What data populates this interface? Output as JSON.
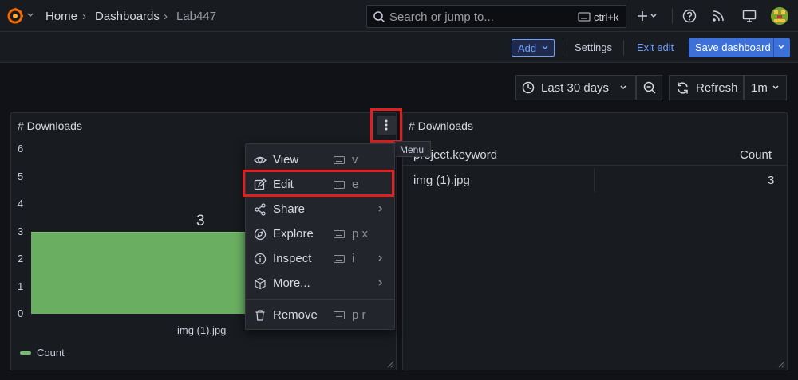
{
  "nav": {
    "breadcrumbs": [
      "Home",
      "Dashboards",
      "Lab447"
    ],
    "search_placeholder": "Search or jump to...",
    "search_shortcut": "ctrl+k"
  },
  "toolbar": {
    "add_label": "Add",
    "settings_label": "Settings",
    "exit_edit_label": "Exit edit",
    "save_label": "Save dashboard"
  },
  "time": {
    "range_label": "Last 30 days",
    "refresh_label": "Refresh",
    "interval_label": "1m"
  },
  "panel_left": {
    "title": "# Downloads",
    "tooltip": "Menu",
    "chart_data": {
      "type": "bar",
      "categories": [
        "img (1).jpg"
      ],
      "series": [
        {
          "name": "Count",
          "values": [
            3
          ]
        }
      ],
      "ylim": [
        0,
        6
      ],
      "yticks": [
        "6",
        "5",
        "4",
        "3",
        "2",
        "1",
        "0"
      ],
      "bar_value_label": "3",
      "legend": "bottom-left",
      "color": "#73bf69"
    }
  },
  "panel_right": {
    "title": "# Downloads",
    "columns": [
      "project.keyword",
      "Count"
    ],
    "rows": [
      [
        "img (1).jpg",
        "3"
      ]
    ]
  },
  "menu": {
    "items": [
      {
        "label": "View",
        "shortcut": "v",
        "icon": "eye-icon"
      },
      {
        "label": "Edit",
        "shortcut": "e",
        "icon": "edit-icon"
      },
      {
        "label": "Share",
        "shortcut": "",
        "icon": "share-icon",
        "submenu": true
      },
      {
        "label": "Explore",
        "shortcut": "p x",
        "icon": "compass-icon"
      },
      {
        "label": "Inspect",
        "shortcut": "i",
        "icon": "info-icon",
        "submenu": true
      },
      {
        "label": "More...",
        "shortcut": "",
        "icon": "cube-icon",
        "submenu": true
      },
      {
        "label": "Remove",
        "shortcut": "p r",
        "icon": "trash-icon"
      }
    ]
  }
}
